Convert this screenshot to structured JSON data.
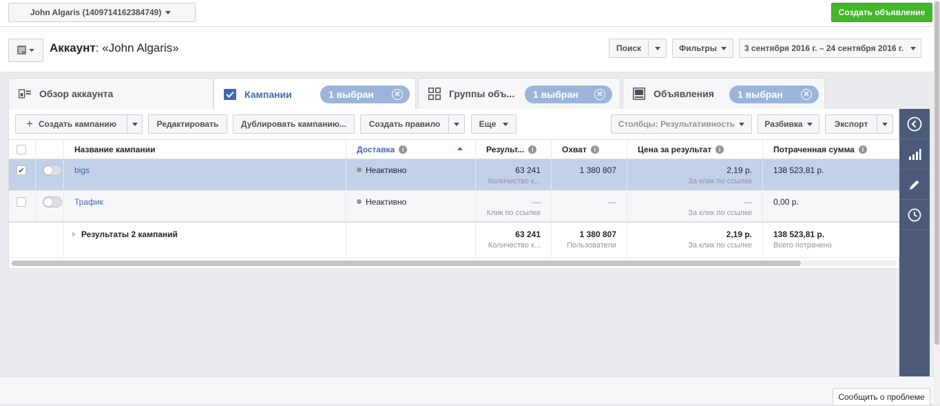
{
  "topbar": {
    "account_selector": "John Algaris (1409714162384749)",
    "create_ad": "Создать объявление"
  },
  "header": {
    "title_prefix": "Аккаунт",
    "title_name": ": «John Algaris»",
    "search": "Поиск",
    "filters": "Фильтры",
    "date_range": "3 сентября 2016 г. – 24 сентября 2016 г."
  },
  "tabs": [
    {
      "label": "Обзор аккаунта"
    },
    {
      "label": "Кампании",
      "pill": "1 выбран"
    },
    {
      "label": "Группы объ...",
      "pill": "1 выбран"
    },
    {
      "label": "Объявления",
      "pill": "1 выбран"
    }
  ],
  "toolbar": {
    "create_campaign": "Создать кампанию",
    "edit": "Редактировать",
    "duplicate": "Дублировать кампанию...",
    "create_rule": "Создать правило",
    "more": "Еще",
    "columns": "Столбцы: Результативность",
    "breakdown": "Разбивка",
    "export": "Экспорт"
  },
  "table": {
    "headers": [
      "Название кампании",
      "Доставка",
      "Результ...",
      "Охват",
      "Цена за результат",
      "Потраченная сумма"
    ],
    "rows": [
      {
        "name": "bigs",
        "delivery": "Неактивно",
        "results": "63 241",
        "results_sub": "Количество к...",
        "reach": "1 380 807",
        "cost": "2,19 р.",
        "cost_sub": "За клик по ссылке",
        "spent": "138 523,81 р.",
        "selected": true
      },
      {
        "name": "Трафик",
        "delivery": "Неактивно",
        "results": "—",
        "results_sub": "Клик по ссылке",
        "reach": "—",
        "cost": "—",
        "cost_sub": "За клик по ссылке",
        "spent": "0,00 р.",
        "selected": false
      }
    ],
    "totals": {
      "label": "Результаты 2 кампаний",
      "results": "63 241",
      "results_sub": "Количество к...",
      "reach": "1 380 807",
      "reach_sub": "Пользователи",
      "cost": "2,19 р.",
      "cost_sub": "За клик по ссылке",
      "spent": "138 523,81 р.",
      "spent_sub": "Всего потрачено"
    }
  },
  "footer": {
    "report_problem": "Сообщить о проблеме"
  },
  "colors": {
    "accent": "#4267b2",
    "create_green": "#42b72a",
    "pill": "#9cb4d8",
    "selected_row": "#c2d1e8",
    "rail": "#4b5a79"
  }
}
